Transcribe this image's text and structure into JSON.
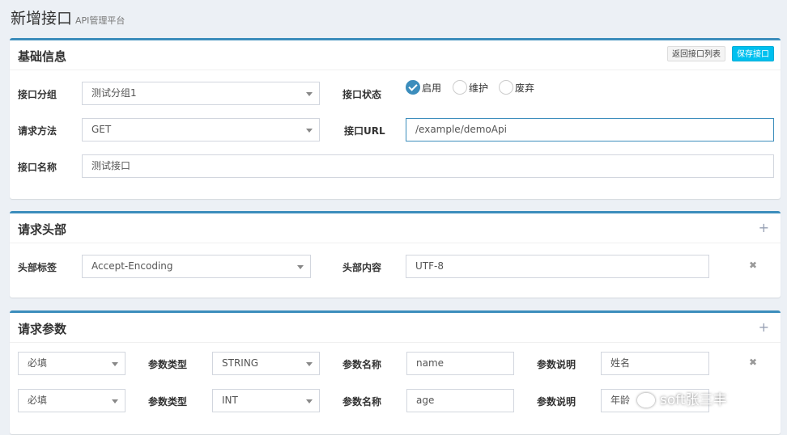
{
  "header": {
    "title": "新增接口",
    "subtitle": "API管理平台"
  },
  "basic": {
    "title": "基础信息",
    "back_button": "返回接口列表",
    "save_button": "保存接口",
    "group_label": "接口分组",
    "group_value": "测试分组1",
    "status_label": "接口状态",
    "status_options": [
      "启用",
      "维护",
      "废弃"
    ],
    "status_selected": "启用",
    "method_label": "请求方法",
    "method_value": "GET",
    "url_label": "接口URL",
    "url_value": "/example/demoApi",
    "name_label": "接口名称",
    "name_value": "测试接口"
  },
  "headers": {
    "title": "请求头部",
    "add_icon": "plus-icon",
    "rows": [
      {
        "key_label": "头部标签",
        "key_value": "Accept-Encoding",
        "value_label": "头部内容",
        "value_value": "UTF-8"
      }
    ]
  },
  "params": {
    "title": "请求参数",
    "add_icon": "plus-icon",
    "rows": [
      {
        "required": "必填",
        "type_label": "参数类型",
        "type_value": "STRING",
        "name_label": "参数名称",
        "name_value": "name",
        "desc_label": "参数说明",
        "desc_value": "姓名"
      },
      {
        "required": "必填",
        "type_label": "参数类型",
        "type_value": "INT",
        "name_label": "参数名称",
        "name_value": "age",
        "desc_label": "参数说明",
        "desc_value": "年龄"
      }
    ]
  },
  "watermark": "soft张三丰",
  "colors": {
    "accent": "#3c8dbc",
    "save": "#00c0ef",
    "background": "#ecf0f5"
  }
}
